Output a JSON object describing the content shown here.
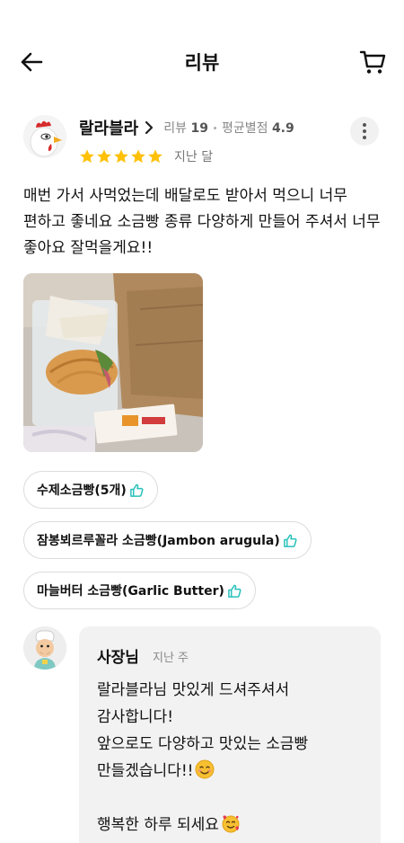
{
  "header": {
    "title": "리뷰",
    "back_icon": "arrow-left-icon",
    "cart_icon": "cart-icon"
  },
  "review": {
    "reviewer_name": "랄라블라",
    "review_count_label": "리뷰",
    "review_count": "19",
    "avg_rating_label": "평균별점",
    "avg_rating": "4.9",
    "stars": 5,
    "star_color": "#FFC107",
    "date": "지난 달",
    "text": "매번 가서 사먹었는데 배달로도 받아서 먹으니 너무 편하고 좋네요 소금빵 종류 다양하게 만들어 주셔서 너무 좋아요 잘먹을게요!!",
    "photo_icon": "food-photo",
    "menu_items": [
      {
        "label": "수제소금빵(5개)"
      },
      {
        "label": "잠봉뵈르루꼴라 소금빵(Jambon arugula)"
      },
      {
        "label": "마늘버터 소금빵(Garlic Butter)"
      }
    ],
    "thumb_color": "#2AC1BC"
  },
  "owner_reply": {
    "name": "사장님",
    "date": "지난 주",
    "lines": [
      "랄라블라님 맛있게 드셔주셔서",
      "감사합니다!",
      "앞으로도 다양하고 맛있는 소금빵",
      "만들겠습니다!!",
      "",
      "행복한 하루 되세요"
    ]
  }
}
